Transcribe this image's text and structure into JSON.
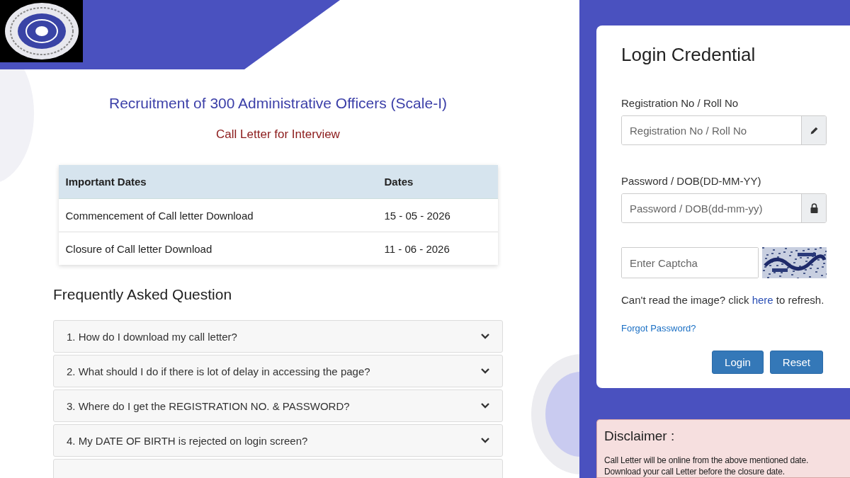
{
  "header": {
    "logo": {
      "kind": "emblem"
    }
  },
  "title": "Recruitment of 300 Administrative Officers (Scale-I)",
  "subtitle": "Call Letter for Interview",
  "dates_table": {
    "columns": [
      "Important Dates",
      "Dates"
    ],
    "rows": [
      [
        "Commencement of Call letter Download",
        "15 - 05 - 2026"
      ],
      [
        "Closure of Call letter Download",
        "11 - 06 - 2026"
      ]
    ]
  },
  "faq": {
    "heading": "Frequently Asked Question",
    "items": [
      {
        "question": "1. How do I download my call letter?",
        "expanded": false
      },
      {
        "question": "2. What should I do if there is lot of delay in accessing the page?",
        "expanded": false
      },
      {
        "question": "3. Where do I get the REGISTRATION NO. & PASSWORD?",
        "expanded": false
      },
      {
        "question": "4. My DATE OF BIRTH is rejected on login screen?",
        "expanded": false
      },
      {
        "kind": "cut_off"
      }
    ]
  },
  "login": {
    "title": "Login Credential",
    "fields": [
      {
        "label": "Registration No / Roll No",
        "placeholder": "Registration No / Roll No",
        "kind": "pencil"
      },
      {
        "label": "Password / DOB(DD-MM-YY)",
        "placeholder": "Password / DOB(dd-mm-yy)",
        "kind": "lock"
      }
    ],
    "captcha": {
      "placeholder": "Enter Captcha"
    },
    "refresh_text": {
      "before": "Can't read the image? click",
      "link": "here",
      "after": "to refresh."
    },
    "forgot_link": "Forgot Password?",
    "buttons": [
      "Login",
      "Reset"
    ]
  },
  "disclaimer": {
    "title": "Disclaimer :",
    "text": "Call Letter will be online from the above mentioned date. Download your call Letter before the closure date."
  }
}
